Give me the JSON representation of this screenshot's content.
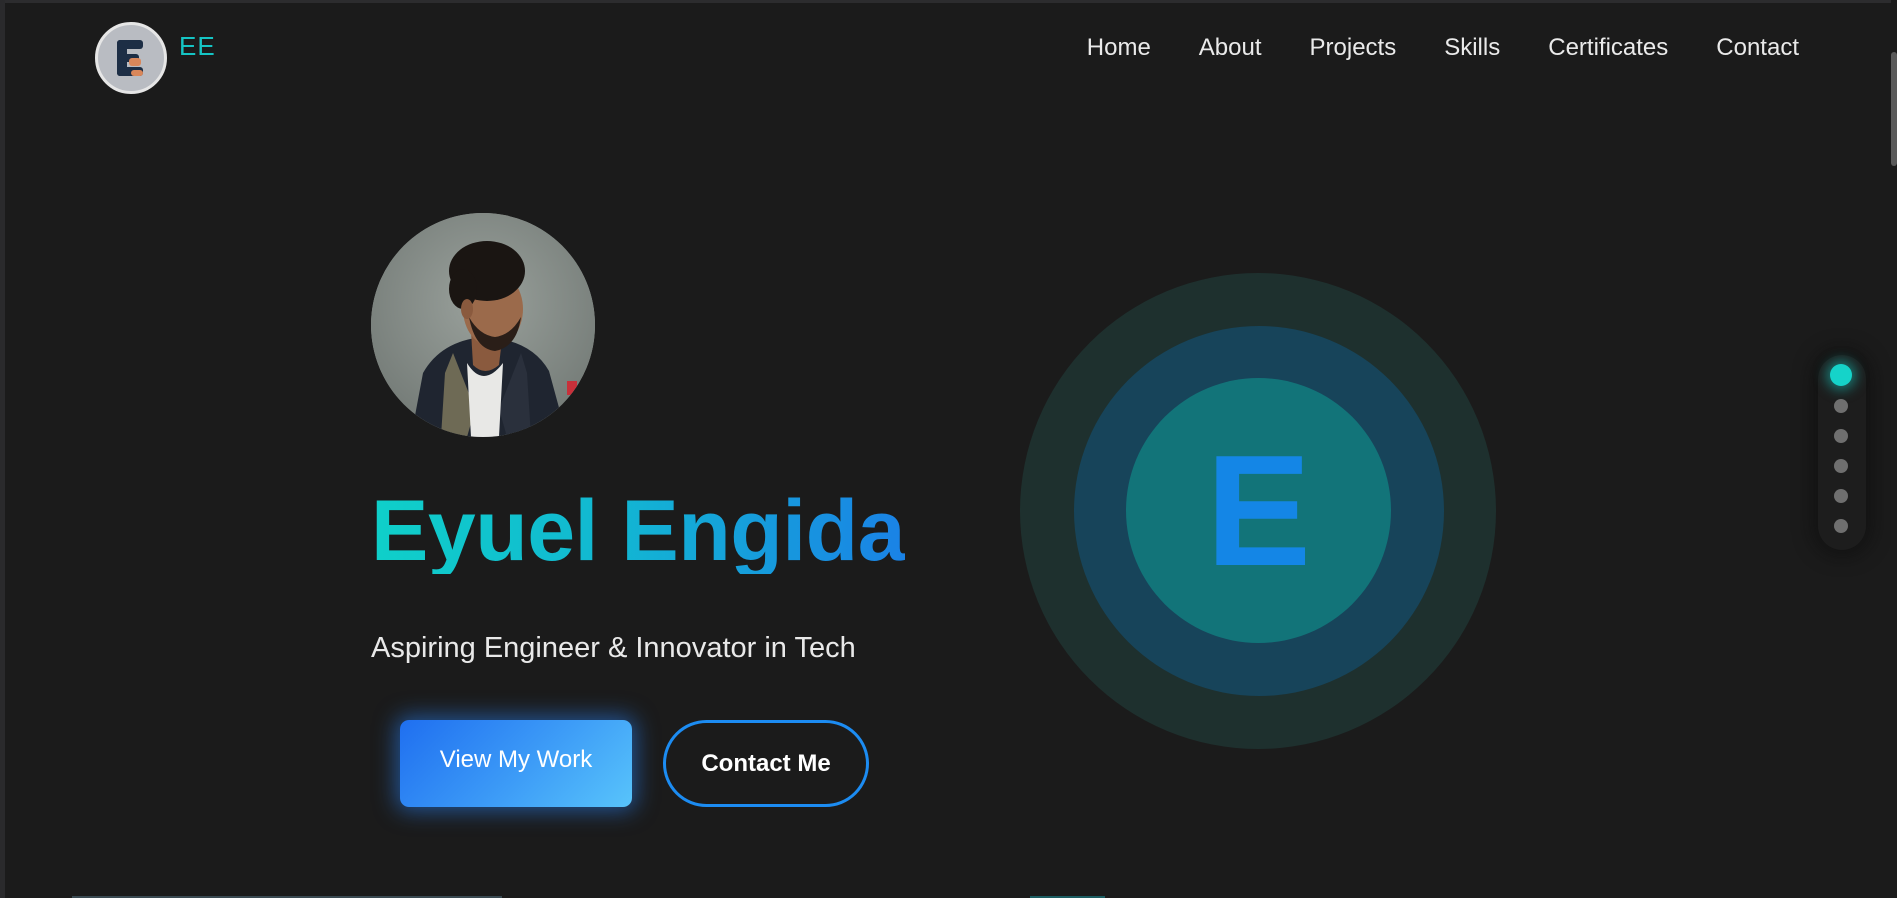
{
  "brand": {
    "logo_letter": "E",
    "initials": "EE",
    "accent_color": "#15c4c4"
  },
  "nav": {
    "items": [
      {
        "label": "Home"
      },
      {
        "label": "About"
      },
      {
        "label": "Projects"
      },
      {
        "label": "Skills"
      },
      {
        "label": "Certificates"
      },
      {
        "label": "Contact"
      }
    ]
  },
  "hero": {
    "name": "Eyuel Engida",
    "tagline": "Aspiring Engineer & Innovator in Tech",
    "primary_button": "View My Work",
    "secondary_button": "Contact Me",
    "avatar": "portrait-photo",
    "emblem_letter": "E"
  },
  "section_indicator": {
    "count": 6,
    "active_index": 0,
    "active_color": "#15d3c9"
  }
}
